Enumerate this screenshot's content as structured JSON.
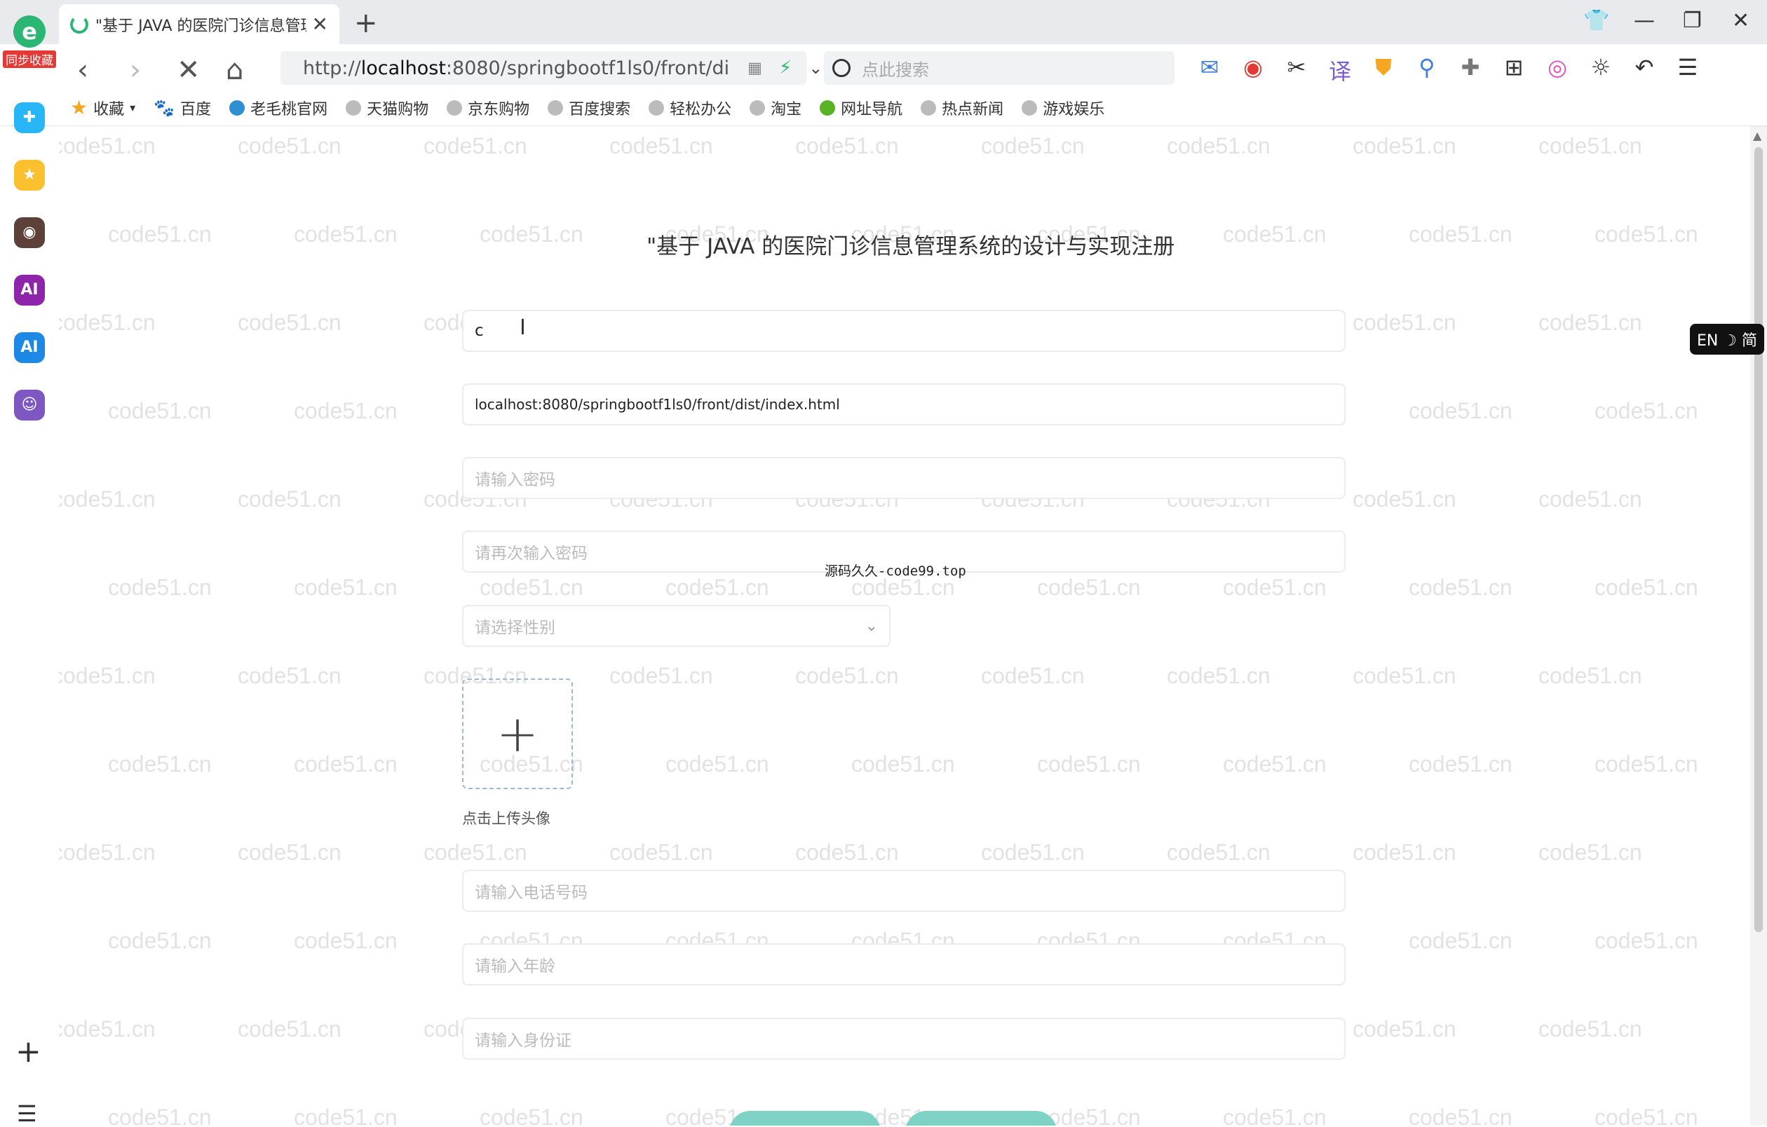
{
  "browser": {
    "tab_title": "\"基于 JAVA 的医院门诊信息管理",
    "url_scheme": "http://",
    "url_host": "localhost",
    "url_rest": ":8080/springbootf1ls0/front/di",
    "search_placeholder": "点此搜索",
    "sync_label": "同步收藏",
    "lang_toggle": "EN ☽ 简"
  },
  "bookmarks": [
    {
      "label": "收藏",
      "icon": "star-icon"
    },
    {
      "label": "百度",
      "icon": "baidu-icon"
    },
    {
      "label": "老毛桃官网",
      "icon": "globe-icon"
    },
    {
      "label": "天猫购物",
      "icon": "globe-icon"
    },
    {
      "label": "京东购物",
      "icon": "globe-icon"
    },
    {
      "label": "百度搜索",
      "icon": "globe-icon"
    },
    {
      "label": "轻松办公",
      "icon": "globe-icon"
    },
    {
      "label": "淘宝",
      "icon": "globe-icon"
    },
    {
      "label": "网址导航",
      "icon": "nav-icon"
    },
    {
      "label": "热点新闻",
      "icon": "globe-icon"
    },
    {
      "label": "游戏娱乐",
      "icon": "globe-icon"
    }
  ],
  "page": {
    "title": "\"基于 JAVA 的医院门诊信息管理系统的设计与实现注册",
    "fields": {
      "account_value": "c",
      "name_value": "localhost:8080/springbootf1ls0/front/dist/index.html",
      "password_placeholder": "请输入密码",
      "password_confirm_placeholder": "请再次输入密码",
      "gender_placeholder": "请选择性别",
      "phone_placeholder": "请输入电话号码",
      "age_placeholder": "请输入年龄",
      "idcard_placeholder": "请输入身份证"
    },
    "upload_tip": "点击上传头像",
    "overlay_watermark": "源码久久-code99.top"
  },
  "watermark_text": "code51.cn",
  "colors": {
    "accent": "#2bb673",
    "button": "#7fd2c6",
    "field_border": "#ececec",
    "upload_border": "#9bb8d4"
  }
}
